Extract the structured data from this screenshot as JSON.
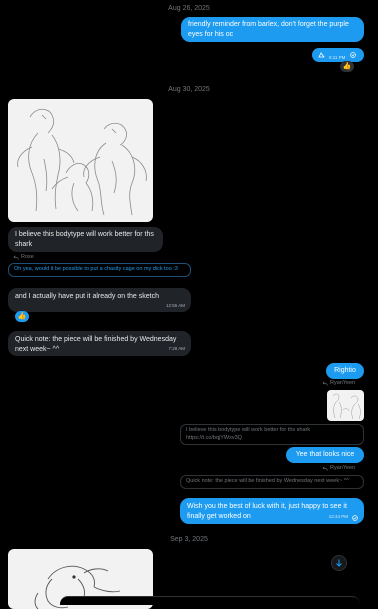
{
  "dates": {
    "d1": "Aug 26, 2025",
    "d2": "Aug 30, 2025",
    "d3": "Sep 3, 2025"
  },
  "messages": {
    "m1": {
      "text": "friendly reminder from barlex, don't forget the purple eyes for his oc"
    },
    "m2": {
      "time": "5:11 PM",
      "reaction": "👍"
    },
    "m3": {
      "text": "I believe this bodytype will work better for ths shark"
    },
    "m4": {
      "reply_label": "Rose",
      "quote": "Oh yea, would it be possible to put a chasity cage on my dick too :3",
      "text": "and I actually have put it already on the sketch",
      "time": "12:55 AM",
      "reaction": "👍"
    },
    "m5": {
      "text": "Quick note: the piece will be finished by Wednesday next week~ ^^",
      "time": "7:28 AM"
    },
    "m6": {
      "text": "Rightio"
    },
    "m7": {
      "reply_label": "RyanYeen",
      "quote": "I believe this bodytype will work better for ths shark https://t.co/bqjYWxv3Q",
      "text": "Yee that looks nice"
    },
    "m8": {
      "reply_label": "RyanYeen",
      "quote": "Quick note: the piece will be finished by Wednesday next week~ ^^",
      "text": "Wish you the best of luck with it, just happy to see it finally get worked on",
      "time": "12:44 PM"
    }
  },
  "icons": {
    "scroll_down": "arrow-down-icon",
    "reply": "reply-arrow-icon",
    "seen": "check-circle-icon"
  },
  "colors": {
    "background": "#000000",
    "sent_bubble": "#1d9bf0",
    "received_bubble": "#202327",
    "link": "#1d9bf0"
  }
}
